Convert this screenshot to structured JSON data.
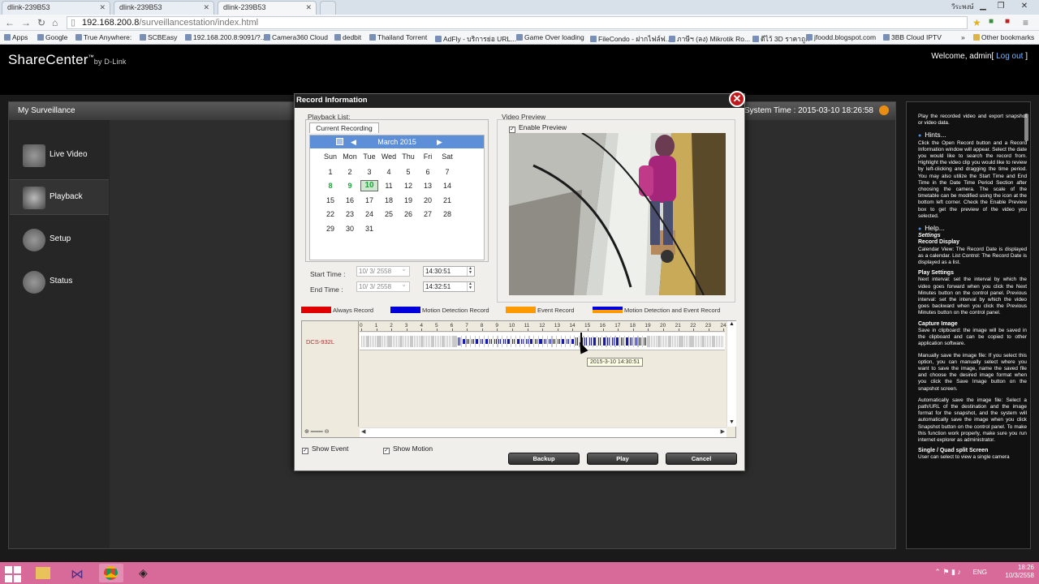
{
  "browser": {
    "tabs": [
      {
        "label": "dlink-239B53",
        "active": false
      },
      {
        "label": "dlink-239B53",
        "active": false
      },
      {
        "label": "dlink-239B53",
        "active": true
      }
    ],
    "user_label": "วีระพงษ์",
    "url_host": "192.168.200.8",
    "url_path": "/surveillancestation/index.html",
    "bookmarks": [
      "Apps",
      "Google",
      "True Anywhere:",
      "SCBEasy",
      "192.168.200.8:9091/?...",
      "Camera360 Cloud",
      "dedbit",
      "Thailand Torrent",
      "AdFly - บริการย่อ URL...",
      "Game Over loading",
      "FileCondo - ฝากไฟล์ฟ...",
      "ภาษีฯ (ลง) Mikrotik Ro...",
      "ดีไว้ 3D ราคาถูก",
      "jfoodd.blogspot.com",
      "3BB Cloud IPTV",
      "Other bookmarks"
    ]
  },
  "app": {
    "logo": "ShareCenter",
    "logo_tm": "™",
    "logo_by": "by D-Link",
    "welcome": "Welcome, admin[",
    "logout": " Log out ",
    "welcome_end": "]",
    "section_title": "My Surveillance",
    "system_time": "System Time : 2015-03-10 18:26:58",
    "nav": [
      {
        "label": "Live Video",
        "icon": "live-video-icon",
        "selected": false
      },
      {
        "label": "Playback",
        "icon": "playback-icon",
        "selected": true
      },
      {
        "label": "Setup",
        "icon": "setup-gear-icon",
        "selected": false
      },
      {
        "label": "Status",
        "icon": "status-icon",
        "selected": false
      }
    ]
  },
  "dialog": {
    "title": "Record Information",
    "playback_list_label": "Playback List:",
    "tab_label": "Current Recording",
    "calendar": {
      "month": "March 2015",
      "dow": [
        "Sun",
        "Mon",
        "Tue",
        "Wed",
        "Thu",
        "Fri",
        "Sat"
      ],
      "weeks": [
        [
          "",
          "",
          "",
          "",
          "",
          "",
          ""
        ],
        [
          "1",
          "2",
          "3",
          "4",
          "5",
          "6",
          "7"
        ],
        [
          "8",
          "9",
          "10",
          "11",
          "12",
          "13",
          "14"
        ],
        [
          "15",
          "16",
          "17",
          "18",
          "19",
          "20",
          "21"
        ],
        [
          "22",
          "23",
          "24",
          "25",
          "26",
          "27",
          "28"
        ],
        [
          "29",
          "30",
          "31",
          "",
          "",
          "",
          ""
        ]
      ],
      "recorded_days": [
        "8",
        "9",
        "10"
      ],
      "selected_day": "10"
    },
    "start_time_label": "Start Time :",
    "end_time_label": "End Time :",
    "start_date": "10/ 3/ 2558",
    "end_date": "10/ 3/ 2558",
    "start_time": "14:30:51",
    "end_time": "14:32:51",
    "video_preview_label": "Video Preview",
    "enable_preview_label": "Enable Preview",
    "enable_preview_checked": true,
    "legend": [
      {
        "label": "Always Record",
        "color": "#e00000"
      },
      {
        "label": "Motion Detection Record",
        "color": "#0000dd"
      },
      {
        "label": "Event Record",
        "color": "#ff9900"
      },
      {
        "label": "Motion Detection and Event Record",
        "color": "#0000dd"
      }
    ],
    "timeline": {
      "hours": [
        "0",
        "1",
        "2",
        "3",
        "4",
        "5",
        "6",
        "7",
        "8",
        "9",
        "10",
        "11",
        "12",
        "13",
        "14",
        "15",
        "16",
        "17",
        "18",
        "19",
        "20",
        "21",
        "22",
        "23",
        "24"
      ],
      "camera": "DCS-932L",
      "tooltip": "2015-3-10 14:30:51"
    },
    "show_event_label": "Show Event",
    "show_motion_label": "Show Motion",
    "backup_label": "Backup",
    "play_label": "Play",
    "cancel_label": "Cancel"
  },
  "help": {
    "intro": "Play the recorded video and export snapshot or video data.",
    "hints_title": "Hints...",
    "hints_text": "Click the Open Record button and a Record Information window will appear. Select the date you would like to search the record from. Highlight the video clip you would like to review by left-clicking and dragging the time period. You may also utilize the Start Time and End Time in the Date Time Period Section after choosing the camera. The scale of the timetable can be modified using the icon at the bottom left corner. Check the Enable Preview box to get the preview of the video you selected.",
    "help_title": "Help...",
    "settings": "Settings",
    "record_display": "Record Display",
    "record_display_text": "Calendar View: The Record Date is displayed as a calendar. List Control: The Record Date is displayed as a list.",
    "play_settings": "Play Settings",
    "play_settings_text": "Next interval: set the interval by which the video goes forward when you click the Next Minutes button on the control panel. Previous interval: set the interval by which the video goes backward when you click the Previous Minutes button on the control panel.",
    "capture_image": "Capture Image",
    "capture_text_1": "Save in clipboard: the image will be saved in the clipboard and can be copied to other application software.",
    "capture_text_2": "Manually save the image file: If you select this option, you can manually select where you want to save the image, name the saved file and choose the desired image format when you click the Save Image button on the snapshot screen.",
    "capture_text_3": "Automatically save the image file: Select a path/URL of the destination and the image format for the snapshot, and the system will automatically save the image when you click Snapshot button on the control panel. To make this function work properly, make sure you run internet explorer as administrator.",
    "split_title": "Single / Quad split Screen",
    "split_text": "User can select to view a single camera"
  },
  "taskbar": {
    "lang": "ENG",
    "time": "18:26",
    "date": "10/3/2558",
    "apps": [
      "file-explorer-icon",
      "visual-studio-icon",
      "chrome-icon",
      "surveillance-app-icon"
    ]
  }
}
